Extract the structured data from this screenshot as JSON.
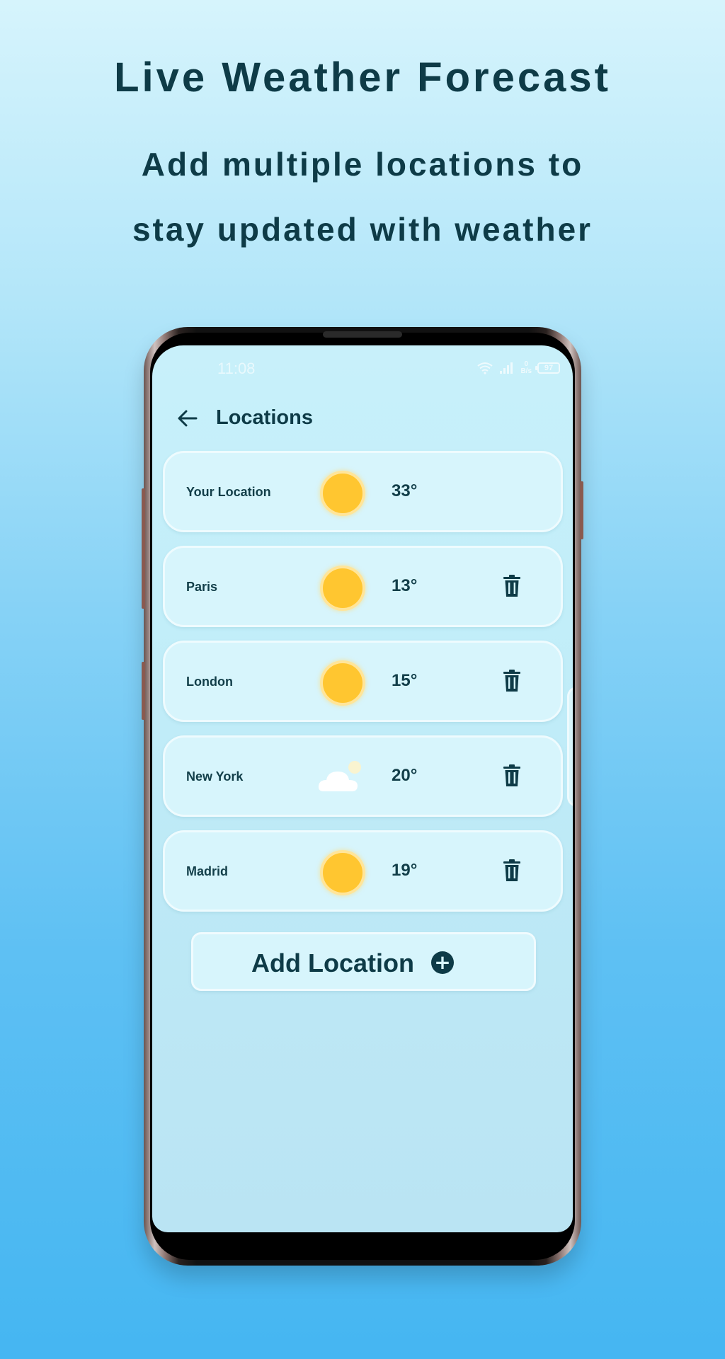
{
  "promo": {
    "title": "Live Weather Forecast",
    "subtitle_line1": "Add multiple locations to",
    "subtitle_line2": "stay updated with weather"
  },
  "status_bar": {
    "time": "11:08",
    "network_speed_value": "0",
    "network_speed_unit": "B/s",
    "battery": "97"
  },
  "app_bar": {
    "title": "Locations",
    "back_icon": "arrow-left-icon"
  },
  "locations": [
    {
      "name": "Your Location",
      "temp": "33°",
      "condition": "sun-icon",
      "deletable": false
    },
    {
      "name": "Paris",
      "temp": "13°",
      "condition": "sun-icon",
      "deletable": true
    },
    {
      "name": "London",
      "temp": "15°",
      "condition": "sun-icon",
      "deletable": true
    },
    {
      "name": "New York",
      "temp": "20°",
      "condition": "cloud-icon",
      "deletable": true
    },
    {
      "name": "Madrid",
      "temp": "19°",
      "condition": "sun-icon",
      "deletable": true
    }
  ],
  "add_location": {
    "label": "Add Location",
    "icon": "plus-circle-icon"
  },
  "colors": {
    "text_dark": "#0e3b47",
    "sun": "#ffc630",
    "card": "#d7f5fc"
  }
}
